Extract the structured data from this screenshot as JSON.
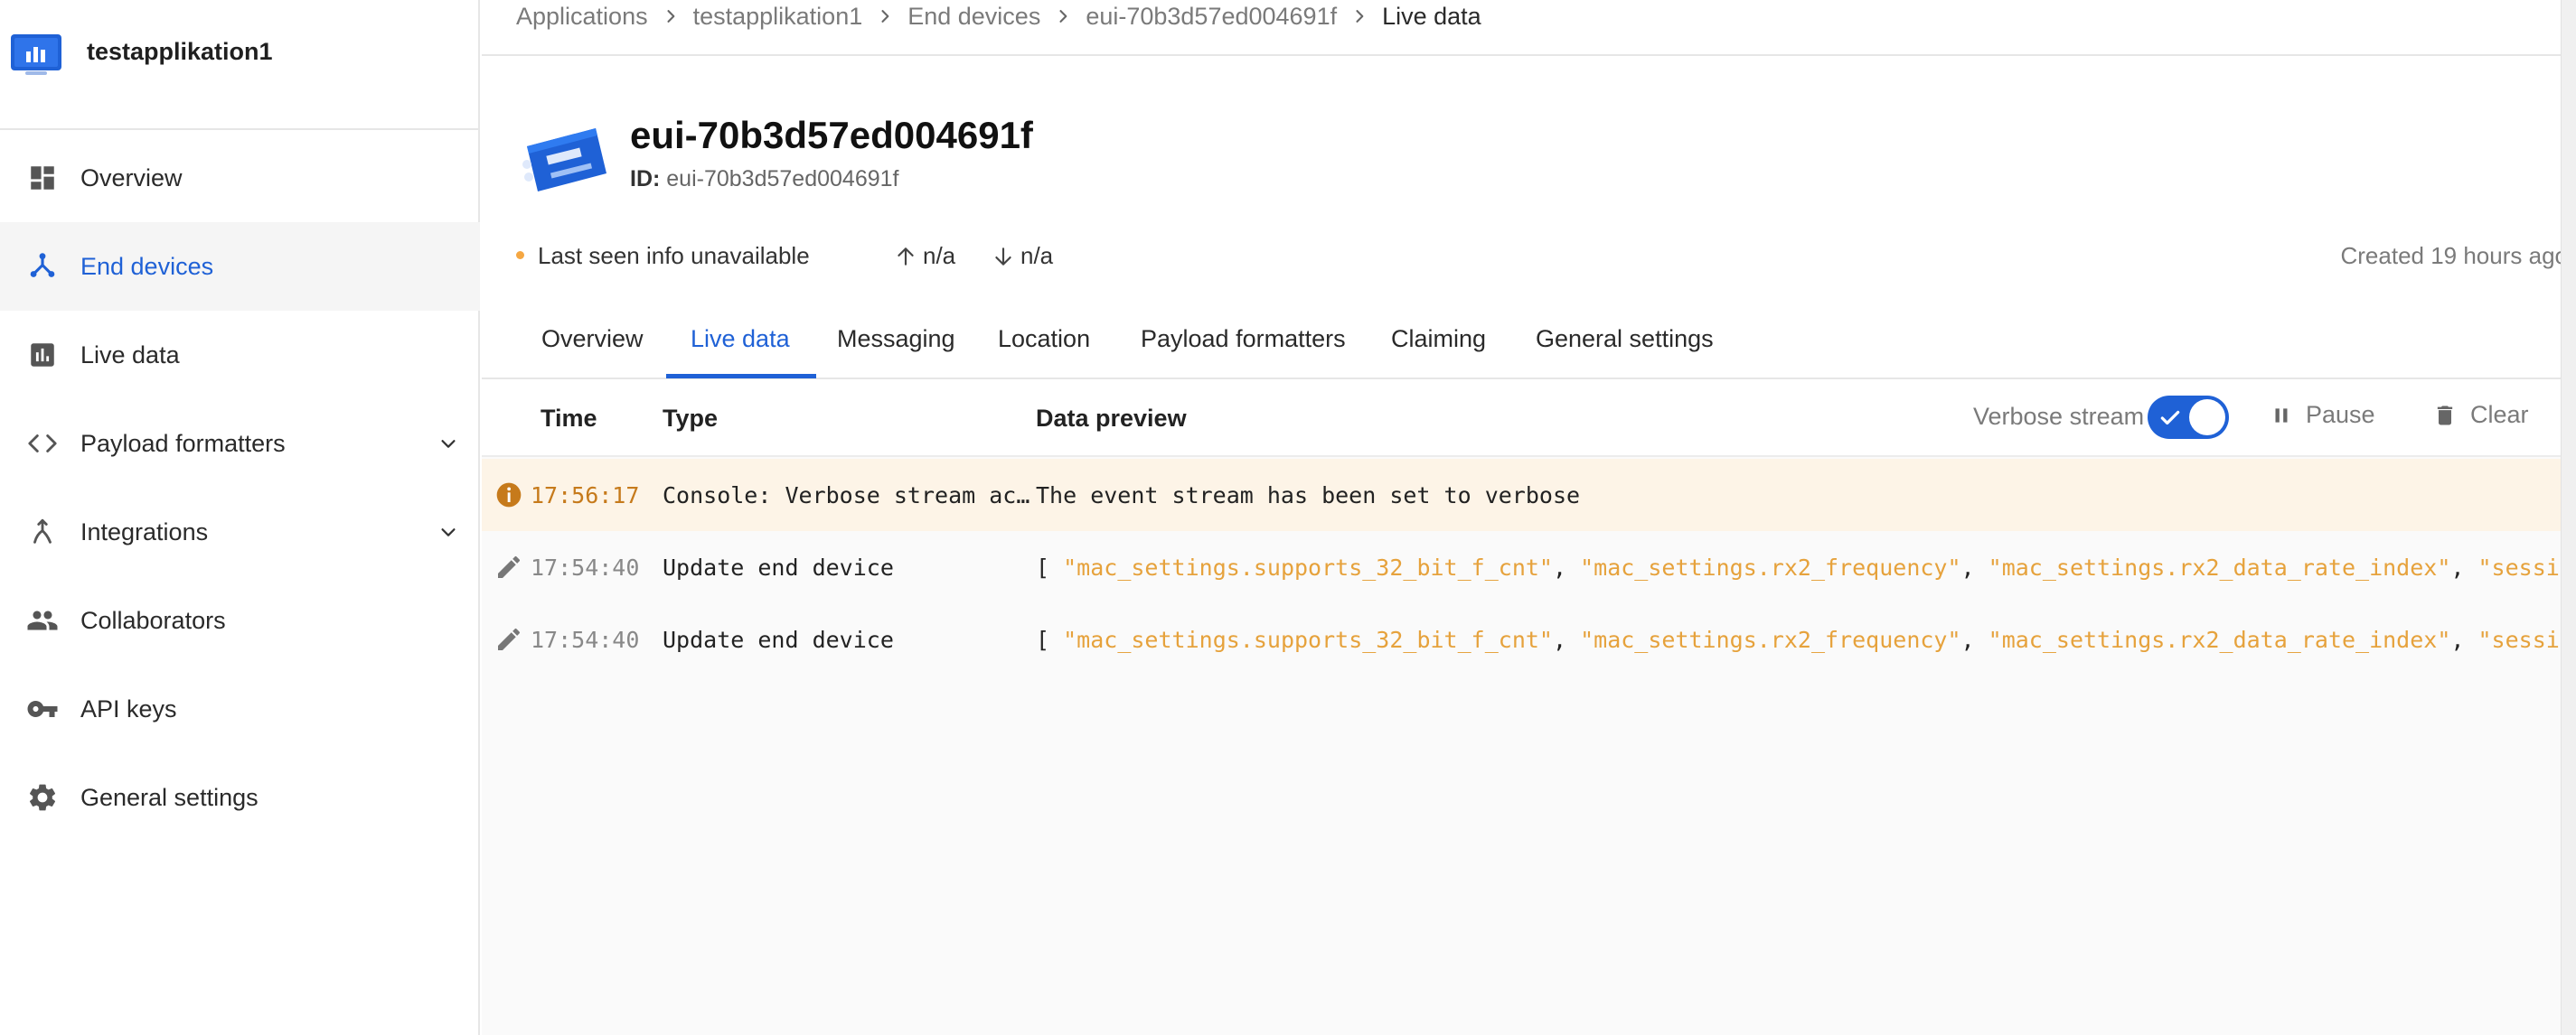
{
  "app": {
    "name": "testapplikation1"
  },
  "sidebar": {
    "items": [
      {
        "label": "Overview",
        "icon": "dashboard-icon",
        "active": false
      },
      {
        "label": "End devices",
        "icon": "end-devices-icon",
        "active": true
      },
      {
        "label": "Live data",
        "icon": "bar-chart-icon",
        "active": false
      },
      {
        "label": "Payload formatters",
        "icon": "code-icon",
        "active": false
      },
      {
        "label": "Integrations",
        "icon": "integrations-icon",
        "active": false
      },
      {
        "label": "Collaborators",
        "icon": "people-icon",
        "active": false
      },
      {
        "label": "API keys",
        "icon": "key-icon",
        "active": false
      },
      {
        "label": "General settings",
        "icon": "gear-icon",
        "active": false
      }
    ]
  },
  "breadcrumb": [
    "Applications",
    "testapplikation1",
    "End devices",
    "eui-70b3d57ed004691f",
    "Live data"
  ],
  "device": {
    "title": "eui-70b3d57ed004691f",
    "id_label": "ID:",
    "id_value": "eui-70b3d57ed004691f",
    "last_seen": "Last seen info unavailable",
    "uplink": "n/a",
    "downlink": "n/a",
    "created": "Created 19 hours ago"
  },
  "tabs": [
    "Overview",
    "Live data",
    "Messaging",
    "Location",
    "Payload formatters",
    "Claiming",
    "General settings"
  ],
  "active_tab": "Live data",
  "table": {
    "headers": {
      "time": "Time",
      "type": "Type",
      "preview": "Data preview"
    },
    "verbose_label": "Verbose stream",
    "verbose_on": true,
    "pause_label": "Pause",
    "clear_label": "Clear",
    "rows": [
      {
        "kind": "info",
        "icon": "info-icon",
        "time": "17:56:17",
        "type": "Console: Verbose stream ac…",
        "preview_text": "The event stream has been set to verbose"
      },
      {
        "kind": "update",
        "icon": "pencil-icon",
        "time": "17:54:40",
        "type": "Update end device",
        "preview_open": "[",
        "preview_strings": [
          "\"mac_settings.supports_32_bit_f_cnt\"",
          "\"mac_settings.rx2_frequency\"",
          "\"mac_settings.rx2_data_rate_index\"",
          "\"session\""
        ],
        "preview_close": "]"
      },
      {
        "kind": "update",
        "icon": "pencil-icon",
        "time": "17:54:40",
        "type": "Update end device",
        "preview_open": "[",
        "preview_strings": [
          "\"mac_settings.supports_32_bit_f_cnt\"",
          "\"mac_settings.rx2_frequency\"",
          "\"mac_settings.rx2_data_rate_index\"",
          "\"session\""
        ],
        "preview_close": "]"
      }
    ]
  },
  "colors": {
    "accent": "#1f61d6",
    "warning": "#f5a742",
    "info_row_bg": "#fdf4e7",
    "string": "#e6a23c"
  }
}
